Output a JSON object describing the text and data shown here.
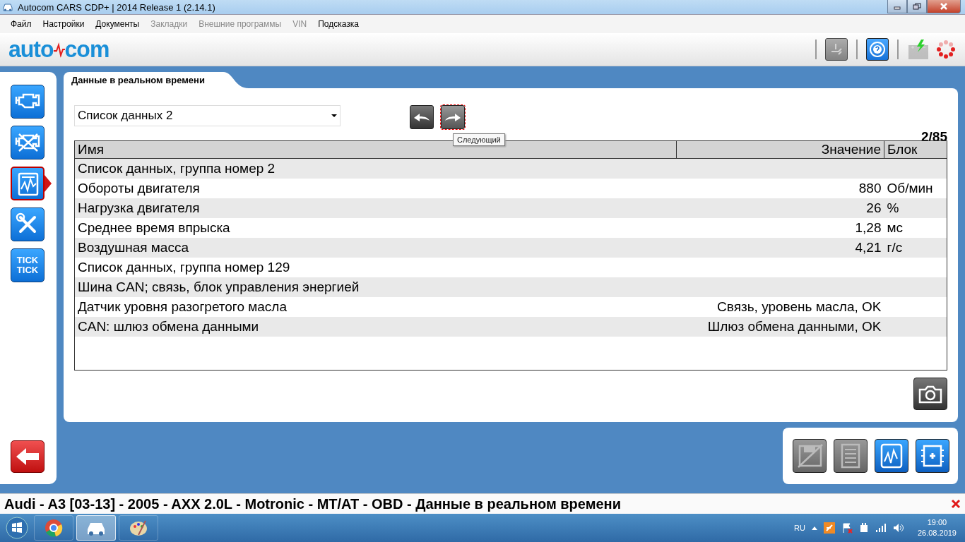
{
  "window": {
    "title": "Autocom CARS CDP+ | 2014 Release 1 (2.14.1)"
  },
  "menu": [
    {
      "label": "Файл",
      "disabled": false
    },
    {
      "label": "Настройки",
      "disabled": false
    },
    {
      "label": "Документы",
      "disabled": false
    },
    {
      "label": "Закладки",
      "disabled": true
    },
    {
      "label": "Внешние программы",
      "disabled": true
    },
    {
      "label": "VIN",
      "disabled": true
    },
    {
      "label": "Подсказка",
      "disabled": false
    }
  ],
  "logo": {
    "left": "auto",
    "right": "com"
  },
  "header_tools": [
    {
      "kind": "obd",
      "disabled": true
    },
    {
      "kind": "help",
      "disabled": false
    },
    {
      "kind": "battery",
      "disabled": true
    },
    {
      "kind": "spinner",
      "disabled": false
    }
  ],
  "sidebar": {
    "items": [
      {
        "kind": "engine",
        "selected": false
      },
      {
        "kind": "engine-off",
        "selected": false
      },
      {
        "kind": "live-data",
        "selected": true
      },
      {
        "kind": "tools",
        "selected": false
      },
      {
        "kind": "text",
        "selected": false,
        "lines": [
          "TICK",
          "TICK"
        ]
      }
    ]
  },
  "tab": {
    "label": "Данные в реальном времени"
  },
  "dropdown": {
    "value": "Список данных 2"
  },
  "nav": [
    {
      "kind": "back",
      "focused": false
    },
    {
      "kind": "next",
      "focused": true
    }
  ],
  "tooltip": "Следующий",
  "counter": "2/85",
  "table": {
    "columns": [
      "Имя",
      "Значение",
      "Блок"
    ],
    "rows": [
      {
        "name": "Список данных, группа номер 2"
      },
      {
        "name": "Обороты двигателя",
        "value": "880",
        "unit": "Об/мин"
      },
      {
        "name": "Нагрузка двигателя",
        "value": "26",
        "unit": "%"
      },
      {
        "name": "Среднее время впрыска",
        "value": "1,28",
        "unit": "мс"
      },
      {
        "name": "Воздушная масса",
        "value": "4,21",
        "unit": "г/с"
      },
      {
        "name": "Список данных, группа номер 129"
      },
      {
        "name": "Шина CAN; связь, блок управления энергией"
      },
      {
        "name": "Датчик уровня разогретого масла",
        "value": "Связь, уровень масла, OK"
      },
      {
        "name": "CAN: шлюз обмена данными",
        "value": "Шлюз обмена данными, OK"
      }
    ]
  },
  "tools": [
    {
      "kind": "save",
      "disabled": true
    },
    {
      "kind": "list",
      "disabled": true
    },
    {
      "kind": "graph",
      "disabled": false
    },
    {
      "kind": "module",
      "disabled": false
    }
  ],
  "status_bar": {
    "text": "Audi - A3 [03-13] - 2005 - AXX 2.0L - Motronic - MT/AT - OBD - Данные в реальном времени"
  },
  "taskbar": {
    "apps": [
      {
        "kind": "browser",
        "selected": false
      },
      {
        "kind": "car",
        "selected": true
      },
      {
        "kind": "paint",
        "selected": false
      }
    ],
    "language": "RU",
    "time": "19:00",
    "date": "26.08.2019"
  }
}
